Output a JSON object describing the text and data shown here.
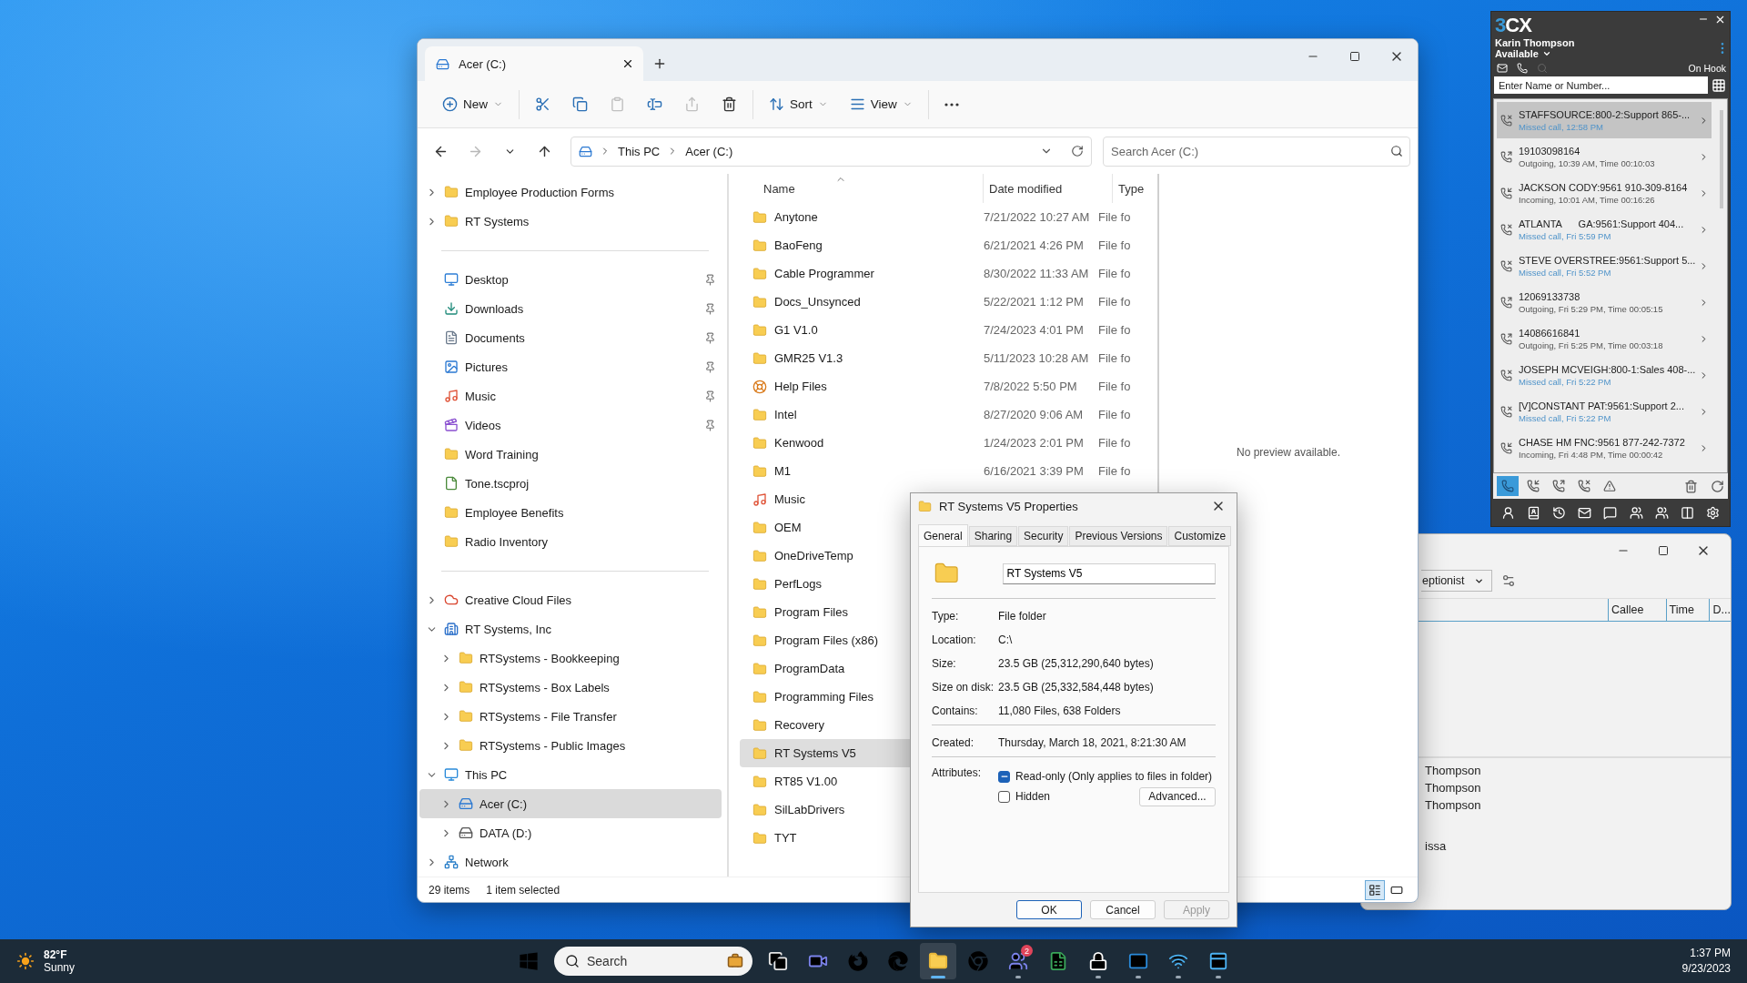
{
  "explorer": {
    "tabs": [
      {
        "label": "Acer (C:)",
        "selected": true
      }
    ],
    "toolbar": [
      {
        "items": [
          {
            "kind": "new",
            "label": "New",
            "disabled": false
          }
        ]
      },
      {
        "items": [
          {
            "kind": "cut",
            "disabled": false
          },
          {
            "kind": "copy",
            "disabled": false
          },
          {
            "kind": "paste",
            "disabled": true
          },
          {
            "kind": "rename",
            "disabled": false
          },
          {
            "kind": "share",
            "disabled": true
          },
          {
            "kind": "delete",
            "disabled": false
          }
        ]
      },
      {
        "items": [
          {
            "kind": "sort",
            "label": "Sort",
            "disabled": false
          },
          {
            "kind": "view",
            "label": "View",
            "disabled": false
          }
        ]
      },
      {
        "items": [
          {
            "kind": "more",
            "disabled": false
          }
        ]
      }
    ],
    "nav_buttons": [
      {
        "kind": "back",
        "disabled": false
      },
      {
        "kind": "forward",
        "disabled": true
      },
      {
        "kind": "recent",
        "disabled": false
      },
      {
        "kind": "up",
        "disabled": false
      }
    ],
    "address": [
      "This PC",
      "Acer (C:)"
    ],
    "search": {
      "placeholder": "Search Acer (C:)"
    },
    "nav_groups": [
      {
        "items": [
          {
            "label": "Employee Production Forms",
            "kind": "folder",
            "expanded": false,
            "selected": false
          },
          {
            "label": "RT Systems",
            "kind": "folder",
            "expanded": false,
            "selected": false
          }
        ]
      },
      {
        "items": [
          {
            "label": "Desktop",
            "kind": "desktop",
            "pinned": true,
            "selected": false
          },
          {
            "label": "Downloads",
            "kind": "download",
            "pinned": true,
            "selected": false
          },
          {
            "label": "Documents",
            "kind": "documents",
            "pinned": true,
            "selected": false
          },
          {
            "label": "Pictures",
            "kind": "pictures",
            "pinned": true,
            "selected": false
          },
          {
            "label": "Music",
            "kind": "music",
            "pinned": true,
            "selected": false
          },
          {
            "label": "Videos",
            "kind": "videos",
            "pinned": true,
            "selected": false
          },
          {
            "label": "Word Training",
            "kind": "folder",
            "pinned": false,
            "selected": false
          },
          {
            "label": "Tone.tscproj",
            "kind": "file",
            "pinned": false,
            "selected": false
          },
          {
            "label": "Employee Benefits",
            "kind": "folder",
            "pinned": false,
            "selected": false
          },
          {
            "label": "Radio Inventory",
            "kind": "folder",
            "pinned": false,
            "selected": false
          }
        ]
      },
      {
        "items": [
          {
            "label": "Creative Cloud Files",
            "kind": "cloud",
            "expanded": false,
            "selected": false
          },
          {
            "label": "RT Systems, Inc",
            "kind": "company",
            "expanded": true,
            "selected": false,
            "children": [
              {
                "label": "RTSystems - Bookkeeping",
                "kind": "folder",
                "expanded": false,
                "selected": false
              },
              {
                "label": "RTSystems - Box Labels",
                "kind": "folder",
                "expanded": false,
                "selected": false
              },
              {
                "label": "RTSystems - File Transfer",
                "kind": "folder",
                "expanded": false,
                "selected": false
              },
              {
                "label": "RTSystems - Public Images",
                "kind": "folder",
                "expanded": false,
                "selected": false
              }
            ]
          },
          {
            "label": "This PC",
            "kind": "pc",
            "expanded": true,
            "selected": false,
            "children": [
              {
                "label": "Acer (C:)",
                "kind": "windrive",
                "expanded": false,
                "selected": true
              },
              {
                "label": "DATA (D:)",
                "kind": "drive",
                "expanded": false,
                "selected": false
              }
            ]
          },
          {
            "label": "Network",
            "kind": "network",
            "expanded": false,
            "selected": false
          }
        ]
      }
    ],
    "columns": [
      "Name",
      "Date modified",
      "Type"
    ],
    "rows": [
      {
        "name": "Anytone",
        "kind": "folder",
        "date": "7/21/2022 10:27 AM",
        "type": "File fo",
        "selected": false
      },
      {
        "name": "BaoFeng",
        "kind": "folder",
        "date": "6/21/2021 4:26 PM",
        "type": "File fo",
        "selected": false
      },
      {
        "name": "Cable Programmer",
        "kind": "folder",
        "date": "8/30/2022 11:33 AM",
        "type": "File fo",
        "selected": false
      },
      {
        "name": "Docs_Unsynced",
        "kind": "folder",
        "date": "5/22/2021 1:12 PM",
        "type": "File fo",
        "selected": false
      },
      {
        "name": "G1 V1.0",
        "kind": "folder",
        "date": "7/24/2023 4:01 PM",
        "type": "File fo",
        "selected": false
      },
      {
        "name": "GMR25 V1.3",
        "kind": "folder",
        "date": "5/11/2023 10:28 AM",
        "type": "File fo",
        "selected": false
      },
      {
        "name": "Help Files",
        "kind": "help",
        "date": "7/8/2022 5:50 PM",
        "type": "File fo",
        "selected": false
      },
      {
        "name": "Intel",
        "kind": "folder",
        "date": "8/27/2020 9:06 AM",
        "type": "File fo",
        "selected": false
      },
      {
        "name": "Kenwood",
        "kind": "folder",
        "date": "1/24/2023 2:01 PM",
        "type": "File fo",
        "selected": false
      },
      {
        "name": "M1",
        "kind": "folder",
        "date": "6/16/2021 3:39 PM",
        "type": "File fo",
        "selected": false
      },
      {
        "name": "Music",
        "kind": "music",
        "selected": false
      },
      {
        "name": "OEM",
        "kind": "folder",
        "selected": false
      },
      {
        "name": "OneDriveTemp",
        "kind": "folder",
        "selected": false
      },
      {
        "name": "PerfLogs",
        "kind": "folder",
        "selected": false
      },
      {
        "name": "Program Files",
        "kind": "folder",
        "selected": false
      },
      {
        "name": "Program Files (x86)",
        "kind": "folder",
        "selected": false
      },
      {
        "name": "ProgramData",
        "kind": "folder",
        "selected": false
      },
      {
        "name": "Programming Files",
        "kind": "folder",
        "selected": false
      },
      {
        "name": "Recovery",
        "kind": "folder",
        "selected": false
      },
      {
        "name": "RT Systems V5",
        "kind": "folder",
        "selected": true
      },
      {
        "name": "RT85 V1.00",
        "kind": "folder",
        "selected": false
      },
      {
        "name": "SilLabDrivers",
        "kind": "folder",
        "selected": false
      },
      {
        "name": "TYT",
        "kind": "folder",
        "selected": false
      }
    ],
    "preview": "No preview available.",
    "status": [
      "29 items",
      "1 item selected"
    ],
    "views": [
      {
        "kind": "details",
        "selected": true
      },
      {
        "kind": "preview",
        "selected": false
      }
    ]
  },
  "properties": {
    "title": "RT Systems V5 Properties",
    "tabs": [
      {
        "label": "General",
        "selected": true
      },
      {
        "label": "Sharing",
        "selected": false
      },
      {
        "label": "Security",
        "selected": false
      },
      {
        "label": "Previous Versions",
        "selected": false
      },
      {
        "label": "Customize",
        "selected": false
      }
    ],
    "name": "RT Systems V5",
    "details": [
      {
        "label": "Type:",
        "value": "File folder"
      },
      {
        "label": "Location:",
        "value": "C:\\"
      },
      {
        "label": "Size:",
        "value": "23.5 GB (25,312,290,640 bytes)"
      },
      {
        "label": "Size on disk:",
        "value": "23.5 GB (25,332,584,448 bytes)"
      },
      {
        "label": "Contains:",
        "value": "11,080 Files, 638 Folders"
      }
    ],
    "dates": [
      {
        "label": "Created:",
        "value": "Thursday, March 18, 2021, 8:21:30 AM"
      }
    ],
    "attributes_label": "Attributes:",
    "attributes": [
      {
        "label": "Read-only (Only applies to files in folder)",
        "mixed": true
      },
      {
        "label": "Hidden",
        "mixed": false
      }
    ],
    "advanced": "Advanced...",
    "buttons": [
      {
        "label": "OK",
        "kind": "default"
      },
      {
        "label": "Cancel",
        "kind": "normal"
      },
      {
        "label": "Apply",
        "kind": "disabled"
      }
    ]
  },
  "phone": {
    "logo": "3CX",
    "user": "Karin Thompson",
    "status": "Available",
    "hook": "On Hook",
    "search": {
      "placeholder": "Enter Name or Number..."
    },
    "calls": [
      {
        "kind": "missed",
        "title": "STAFFSOURCE:800-2:Support 865-...",
        "detail": "Missed call, 12:58 PM",
        "selected": true
      },
      {
        "kind": "outgoing",
        "title": "19103098164",
        "detail": "Outgoing, 10:39 AM, Time 00:10:03",
        "selected": false
      },
      {
        "kind": "incoming",
        "title": "JACKSON CODY:9561 910-309-8164",
        "detail": "Incoming, 10:01 AM, Time 00:16:26",
        "selected": false
      },
      {
        "kind": "missed",
        "title": "ATLANTA      GA:9561:Support 404...",
        "detail": "Missed call, Fri 5:59 PM",
        "selected": false
      },
      {
        "kind": "missed",
        "title": "STEVE OVERSTREE:9561:Support 5...",
        "detail": "Missed call, Fri 5:52 PM",
        "selected": false
      },
      {
        "kind": "outgoing",
        "title": "12069133738",
        "detail": "Outgoing, Fri 5:29 PM, Time 00:05:15",
        "selected": false
      },
      {
        "kind": "outgoing",
        "title": "14086616841",
        "detail": "Outgoing, Fri 5:25 PM, Time 00:03:18",
        "selected": false
      },
      {
        "kind": "missed",
        "title": "JOSEPH MCVEIGH:800-1:Sales 408-...",
        "detail": "Missed call, Fri 5:22 PM",
        "selected": false
      },
      {
        "kind": "missed",
        "title": "[V]CONSTANT PAT:9561:Support 2...",
        "detail": "Missed call, Fri 5:22 PM",
        "selected": false
      },
      {
        "kind": "incoming",
        "title": "CHASE HM FNC:9561 877-242-7372",
        "detail": "Incoming, Fri 4:48 PM, Time 00:00:42",
        "selected": false
      }
    ],
    "filters": [
      {
        "kind": "all",
        "selected": true
      },
      {
        "kind": "incoming",
        "selected": false
      },
      {
        "kind": "outgoing",
        "selected": false
      },
      {
        "kind": "missed",
        "selected": false
      },
      {
        "kind": "warning",
        "selected": false
      }
    ]
  },
  "back_window": {
    "dropdown": "eptionist",
    "columns": [
      "Callee",
      "Time",
      "D..."
    ],
    "rows": [
      "Thompson",
      "Thompson",
      "Thompson",
      "issa"
    ]
  },
  "taskbar": {
    "weather": {
      "temp": "82°F",
      "condition": "Sunny"
    },
    "apps": [
      {
        "kind": "start",
        "running": false,
        "active": false
      },
      {
        "kind": "search",
        "placeholder": "Search"
      },
      {
        "kind": "taskview",
        "running": false,
        "active": false
      },
      {
        "kind": "meet",
        "running": false,
        "active": false
      },
      {
        "kind": "firefox",
        "running": false,
        "active": false
      },
      {
        "kind": "edge",
        "running": false,
        "active": false
      },
      {
        "kind": "explorer",
        "running": true,
        "active": true
      },
      {
        "kind": "chrome",
        "running": false,
        "active": false
      },
      {
        "kind": "teams",
        "running": true,
        "active": false,
        "badge": "2"
      },
      {
        "kind": "sheet",
        "running": false,
        "active": false
      },
      {
        "kind": "lock",
        "running": true,
        "active": false
      },
      {
        "kind": "outlook",
        "running": true,
        "active": false
      },
      {
        "kind": "wifi",
        "running": true,
        "active": false
      },
      {
        "kind": "app",
        "running": true,
        "active": false
      }
    ],
    "time": "1:37 PM",
    "date": "9/23/2023"
  }
}
